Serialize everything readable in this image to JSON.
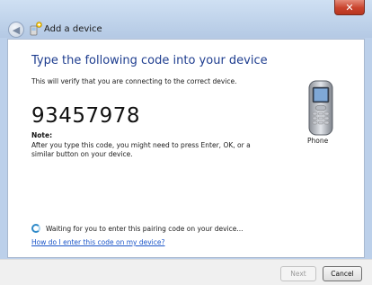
{
  "window": {
    "title": "Add a device",
    "close_symbol": "✕",
    "back_symbol": "◀"
  },
  "content": {
    "heading": "Type the following code into your device",
    "verify_text": "This will verify that you are connecting to the correct device.",
    "pairing_code": "93457978",
    "note_label": "Note:",
    "note_text": "After you type this code, you might need to press Enter, OK, or a similar button on your device.",
    "device_label": "Phone",
    "waiting_text": "Waiting for you to enter this pairing code on your device...",
    "help_link": "How do I enter this code on my device?"
  },
  "footer": {
    "next_label": "Next",
    "cancel_label": "Cancel"
  },
  "colors": {
    "heading": "#1e3d8f",
    "link": "#1b55c9",
    "close_button": "#c9432d",
    "frame": "#bcd0ea"
  },
  "icons": [
    "back-arrow-icon",
    "bluetooth-device-icon",
    "close-icon",
    "phone-icon",
    "spinner-icon"
  ]
}
